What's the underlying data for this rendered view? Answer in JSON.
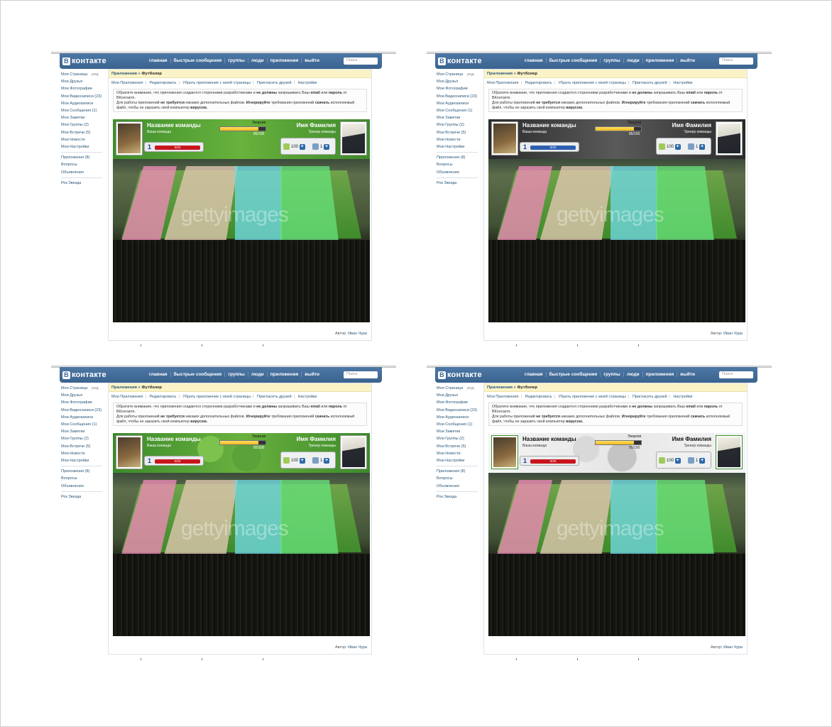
{
  "header": {
    "logo_glyph": "В",
    "logo_text": "контакте",
    "nav": [
      "главная",
      "быстрые сообщения",
      "группы",
      "люди",
      "приложения",
      "выйти"
    ],
    "search_placeholder": "Поиск"
  },
  "sidebar": {
    "edit_label": "ред.",
    "items": [
      "Моя Страница",
      "Мои Друзья",
      "Мои Фотографии",
      "Мои Видеозаписи (23)",
      "Мои Аудиозаписи",
      "Мои Сообщения (1)",
      "Мои Заметки",
      "Мои Группы (2)",
      "Мои Встречи (5)",
      "Мои Новости",
      "Мои Настройки"
    ],
    "items2": [
      "Приложения (8)",
      "Вопросы",
      "Объявления"
    ],
    "items3": [
      "Рок Звезда"
    ]
  },
  "breadcrumb": {
    "section": "Приложения",
    "sep": "»",
    "current": "Футболер"
  },
  "tabs": [
    "Мои Приложения",
    "Редактировать",
    "Убрать приложение с моей страницы",
    "Пригласить друзей",
    "Настройки"
  ],
  "notice": {
    "p1": "Обратите внимание, что приложения создаются сторонними разработчиками и ",
    "p1b": "не должны",
    "p1c": " запрашивать Ваш ",
    "p1d": "email",
    "p1e": " или ",
    "p1f": "пароль",
    "p1g": " от ВКонтакте.",
    "p2": "Для работы приложений ",
    "p2b": "не требуется",
    "p2c": " никаких дополнительных файлов. ",
    "p2d": "Игнорируйте",
    "p2e": " требования приложений ",
    "p2f": "скачать",
    "p2g": " исполняемый файл, чтобы не заразить свой компьютер ",
    "p2h": "вирусом."
  },
  "game": {
    "team_name": "Название команды",
    "team_sub": "Ваша команда",
    "player_name": "Имя Фамилия",
    "player_sub": "Тренер команды",
    "energy_label": "Энергия",
    "energy_value": "85/100",
    "energy_fraction": 0.85,
    "level": "1",
    "level_bar_value": "0/20",
    "money": "100",
    "cards": "1",
    "watermark": "gettyimages"
  },
  "author": {
    "label": "Автор:",
    "name": "Иван Чура"
  },
  "variants": [
    {
      "panel": "green-stadium",
      "level_bar_color": "#c8151c"
    },
    {
      "panel": "dark-stadium",
      "level_bar_color": "#2d5fb0"
    },
    {
      "panel": "green-balls",
      "level_bar_color": "#c8151c"
    },
    {
      "panel": "white-balls",
      "level_bar_color": "#c8151c"
    }
  ],
  "colors": {
    "vk_blue": "#45688e",
    "breadcrumb_bg": "#fbf3c8",
    "link": "#2b587a"
  }
}
